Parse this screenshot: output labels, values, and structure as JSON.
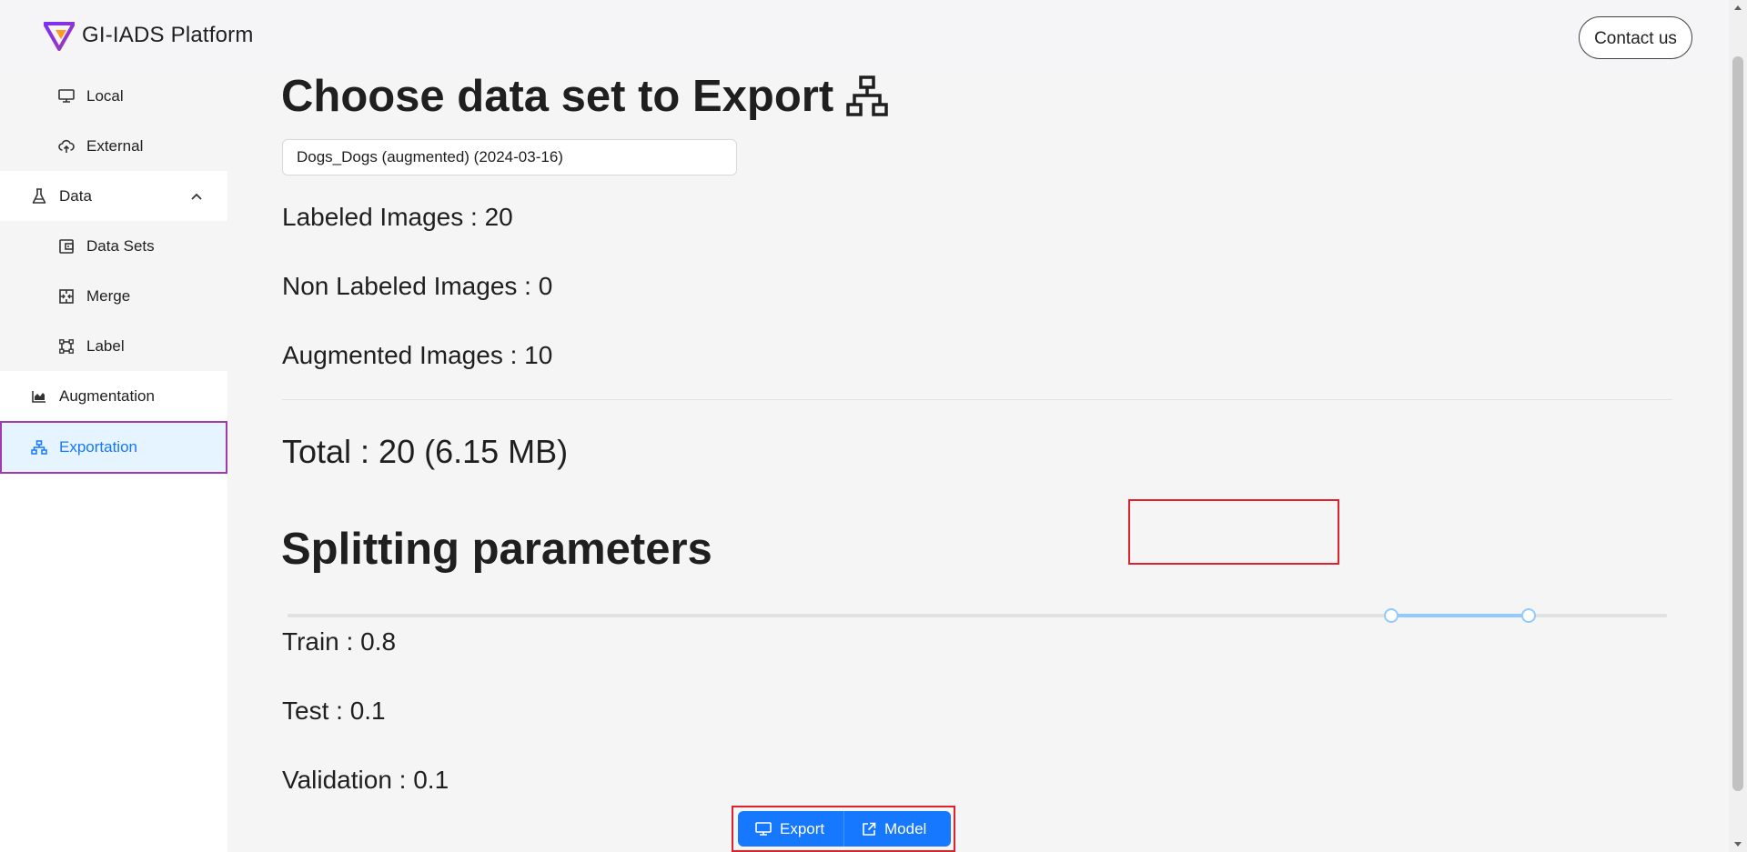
{
  "header": {
    "brand": "GI-IADS Platform",
    "contact_label": "Contact us"
  },
  "sidebar": {
    "models_sub": [
      {
        "label": "Local",
        "icon": "desktop-icon"
      },
      {
        "label": "External",
        "icon": "cloud-upload-icon"
      }
    ],
    "data": {
      "label": "Data",
      "icon": "flask-icon",
      "expanded": true
    },
    "data_sub": [
      {
        "label": "Data Sets",
        "icon": "wallet-icon"
      },
      {
        "label": "Merge",
        "icon": "merge-cells-icon"
      },
      {
        "label": "Label",
        "icon": "bounding-box-icon"
      }
    ],
    "augmentation": {
      "label": "Augmentation",
      "icon": "area-chart-icon"
    },
    "exportation": {
      "label": "Exportation",
      "icon": "cluster-icon",
      "active": true
    }
  },
  "main": {
    "export_title": "Choose data set to Export",
    "dataset_select": "Dogs_Dogs (augmented) (2024-03-16)",
    "labeled": "Labeled Images : 20",
    "non_labeled": "Non Labeled Images : 0",
    "augmented": "Augmented Images : 10",
    "total": "Total : 20 (6.15 MB)",
    "split_title": "Splitting parameters",
    "split_slider": {
      "min": 0,
      "max": 1,
      "handles": [
        0.8,
        0.9
      ]
    },
    "train": "Train : 0.8",
    "test": "Test : 0.1",
    "validation": "Validation : 0.1"
  },
  "buttons": {
    "export_label": "Export",
    "model_label": "Model"
  },
  "colors": {
    "primary": "#1677ff",
    "active_bg": "#e6f4ff",
    "slider_track": "#91caff",
    "highlight_red": "#e0202a",
    "active_outline": "#a03ab0"
  }
}
